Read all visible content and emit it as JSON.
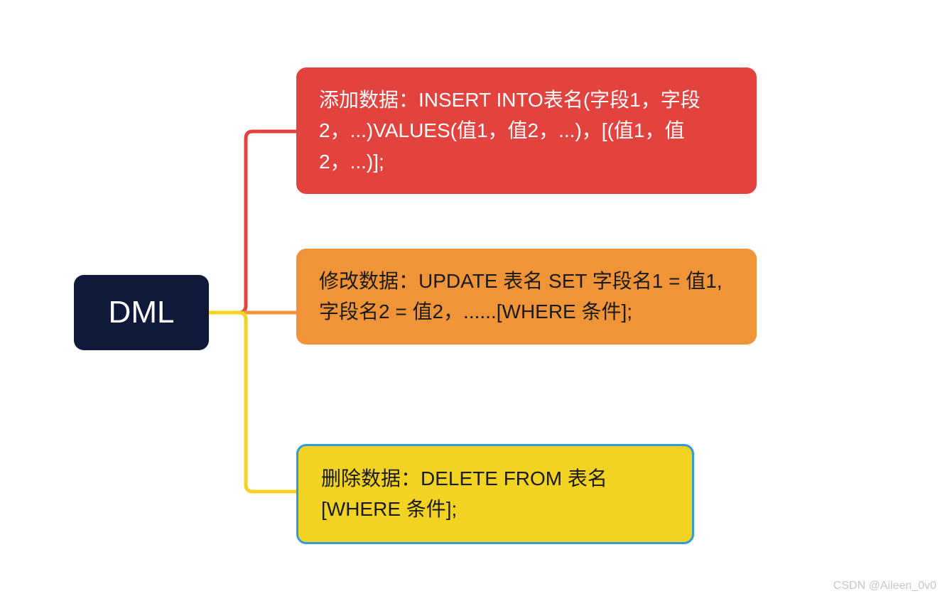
{
  "root": {
    "label": "DML",
    "bg": "#0f1a3a",
    "fg": "#ffffff"
  },
  "children": [
    {
      "text": "添加数据：INSERT INTO表名(字段1，字段2，...)VALUES(值1，值2，...)，[(值1，值2，...)];",
      "bg": "#e2433f",
      "fg": "#ffffff",
      "edge": "#e2433f"
    },
    {
      "text": "修改数据：UPDATE 表名 SET 字段名1 = 值1,字段名2 = 值2，......[WHERE 条件];",
      "bg": "#f09437",
      "fg": "#1a1a1a",
      "edge": "#f09437"
    },
    {
      "text": "删除数据：DELETE FROM 表名 [WHERE 条件];",
      "bg": "#f3d321",
      "fg": "#1a1a1a",
      "edge": "#f3d321"
    }
  ],
  "watermark": "CSDN @Aileen_0v0"
}
